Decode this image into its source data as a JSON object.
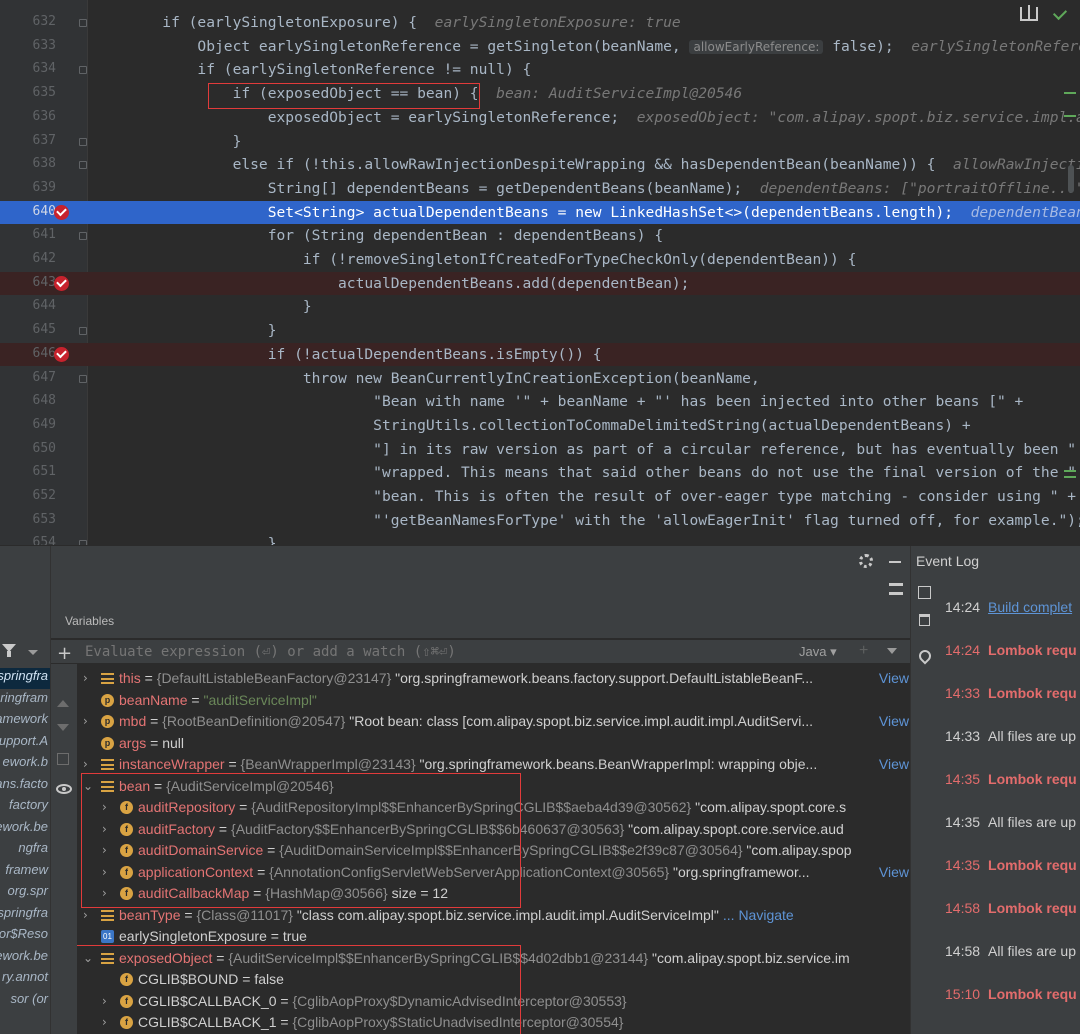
{
  "editor": {
    "lines": [
      {
        "num": "632",
        "code": "        if (earlySingletonExposure) {  ",
        "hint": "earlySingletonExposure: true"
      },
      {
        "num": "633",
        "code": "            Object earlySingletonReference = getSingleton(beanName, ",
        "hintbox": "allowEarlyReference:",
        "code2": " false);  ",
        "hint": "earlySingletonReference"
      },
      {
        "num": "634",
        "code": "            if (earlySingletonReference != null) {"
      },
      {
        "num": "635",
        "code": "                if (exposedObject == bean) {  ",
        "hint": "bean: AuditServiceImpl@20546"
      },
      {
        "num": "636",
        "code": "                    exposedObject = earlySingletonReference;  ",
        "hint": "exposedObject: \"com.alipay.spopt.biz.service.impl.audit"
      },
      {
        "num": "637",
        "code": "                }"
      },
      {
        "num": "638",
        "code": "                else if (!this.allowRawInjectionDespiteWrapping && hasDependentBean(beanName)) {  ",
        "hint": "allowRawInjectionDe"
      },
      {
        "num": "639",
        "code": "                    String[] dependentBeans = getDependentBeans(beanName);  ",
        "hint": "dependentBeans: [\"portraitOffline...\"]"
      },
      {
        "num": "640",
        "code": "                    Set<String> actualDependentBeans = new LinkedHashSet<>(dependentBeans.length);  ",
        "hint": "dependentBeans: ["
      },
      {
        "num": "641",
        "code": "                    for (String dependentBean : dependentBeans) {"
      },
      {
        "num": "642",
        "code": "                        if (!removeSingletonIfCreatedForTypeCheckOnly(dependentBean)) {"
      },
      {
        "num": "643",
        "code": "                            actualDependentBeans.add(dependentBean);"
      },
      {
        "num": "644",
        "code": "                        }"
      },
      {
        "num": "645",
        "code": "                    }"
      },
      {
        "num": "646",
        "code": "                    if (!actualDependentBeans.isEmpty()) {"
      },
      {
        "num": "647",
        "code": "                        throw new BeanCurrentlyInCreationException(beanName,"
      },
      {
        "num": "648",
        "code": "                                \"Bean with name '\" + beanName + \"' has been injected into other beans [\" +"
      },
      {
        "num": "649",
        "code": "                                StringUtils.collectionToCommaDelimitedString(actualDependentBeans) +"
      },
      {
        "num": "650",
        "code": "                                \"] in its raw version as part of a circular reference, but has eventually been \" +"
      },
      {
        "num": "651",
        "code": "                                \"wrapped. This means that said other beans do not use the final version of the \" +"
      },
      {
        "num": "652",
        "code": "                                \"bean. This is often the result of over-eager type matching - consider using \" +"
      },
      {
        "num": "653",
        "code": "                                \"'getBeanNamesForType' with the 'allowEagerInit' flag turned off, for example.\");"
      },
      {
        "num": "654",
        "code": "                    }"
      }
    ]
  },
  "debugger": {
    "frames": [
      "springfra",
      "springfram",
      "framework",
      "upport.A",
      "ework.b",
      "ans.facto",
      "factory",
      "ework.be",
      "ngfra",
      "framew",
      "org.spr",
      "springfra",
      "or$Reso",
      "ework.be",
      "ry.annot",
      "sor (or"
    ],
    "variables_title": "Variables",
    "eval_placeholder": "Evaluate expression (⏎) or add a watch (⇧⌘⏎)",
    "language": "Java ▾",
    "rows": [
      {
        "arrow": "›",
        "icon": "obj",
        "name": "this",
        "type": "{DefaultListableBeanFactory@23147}",
        "value": " \"org.springframework.beans.factory.support.DefaultListableBeanF...",
        "link": "View"
      },
      {
        "arrow": "",
        "icon": "param",
        "name": "beanName",
        "type": "",
        "value": "\"auditServiceImpl\"",
        "str": true
      },
      {
        "arrow": "›",
        "icon": "param",
        "name": "mbd",
        "type": "{RootBeanDefinition@20547}",
        "value": " \"Root bean: class [com.alipay.spopt.biz.service.impl.audit.impl.AuditServi...",
        "link": "View"
      },
      {
        "arrow": "",
        "icon": "param",
        "name": "args",
        "type": "",
        "value": "null",
        "plain": true
      },
      {
        "arrow": "›",
        "icon": "obj",
        "name": "instanceWrapper",
        "type": "{BeanWrapperImpl@23143}",
        "value": " \"org.springframework.beans.BeanWrapperImpl: wrapping obje...",
        "link": "View"
      },
      {
        "arrow": "⌄",
        "icon": "obj",
        "name": "bean",
        "type": "{AuditServiceImpl@20546}",
        "value": ""
      },
      {
        "arrow": "›",
        "icon": "field",
        "indent": 1,
        "name": "auditRepository",
        "type": "{AuditRepositoryImpl$$EnhancerBySpringCGLIB$$aeba4d39@30562}",
        "value": " \"com.alipay.spopt.core.s"
      },
      {
        "arrow": "›",
        "icon": "field",
        "indent": 1,
        "name": "auditFactory",
        "type": "{AuditFactory$$EnhancerBySpringCGLIB$$6b460637@30563}",
        "value": " \"com.alipay.spopt.core.service.aud"
      },
      {
        "arrow": "›",
        "icon": "field",
        "indent": 1,
        "name": "auditDomainService",
        "type": "{AuditDomainServiceImpl$$EnhancerBySpringCGLIB$$e2f39c87@30564}",
        "value": " \"com.alipay.spop"
      },
      {
        "arrow": "›",
        "icon": "field",
        "indent": 1,
        "name": "applicationContext",
        "type": "{AnnotationConfigServletWebServerApplicationContext@30565}",
        "value": " \"org.springframewor...",
        "link": "View"
      },
      {
        "arrow": "›",
        "icon": "field",
        "indent": 1,
        "name": "auditCallbackMap",
        "type": "{HashMap@30566}",
        "value": "  size = 12"
      },
      {
        "arrow": "›",
        "icon": "obj",
        "name": "beanType",
        "type": "{Class@11017}",
        "value": " \"class com.alipay.spopt.biz.service.impl.audit.impl.AuditServiceImpl\"",
        "link": "... Navigate",
        "linkInline": true
      },
      {
        "arrow": "",
        "icon": "bool",
        "name": "earlySingletonExposure",
        "type": "",
        "value": "true",
        "plain": true,
        "plainName": true
      },
      {
        "arrow": "⌄",
        "icon": "obj",
        "name": "exposedObject",
        "type": "{AuditServiceImpl$$EnhancerBySpringCGLIB$$4d02dbb1@23144}",
        "value": " \"com.alipay.spopt.biz.service.im"
      },
      {
        "arrow": "",
        "icon": "field",
        "indent": 1,
        "name": "CGLIB$BOUND",
        "type": "",
        "value": "false",
        "plain": true,
        "plainName": true
      },
      {
        "arrow": "›",
        "icon": "field",
        "indent": 1,
        "name": "CGLIB$CALLBACK_0",
        "type": "{CglibAopProxy$DynamicAdvisedInterceptor@30553}",
        "value": "",
        "plainName": true
      },
      {
        "arrow": "›",
        "icon": "field",
        "indent": 1,
        "name": "CGLIB$CALLBACK_1",
        "type": "{CglibAopProxy$StaticUnadvisedInterceptor@30554}",
        "value": "",
        "plainName": true
      }
    ]
  },
  "event_log": {
    "title": "Event Log",
    "entries": [
      {
        "time": "14:24",
        "msg": "Build complet",
        "kind": "link"
      },
      {
        "time": "14:24",
        "msg": "Lombok requ",
        "kind": "err"
      },
      {
        "time": "14:33",
        "msg": "Lombok requ",
        "kind": "err"
      },
      {
        "time": "14:33",
        "msg": "All files are up",
        "kind": "info"
      },
      {
        "time": "14:35",
        "msg": "Lombok requ",
        "kind": "err"
      },
      {
        "time": "14:35",
        "msg": "All files are up",
        "kind": "info"
      },
      {
        "time": "14:35",
        "msg": "Lombok requ",
        "kind": "err"
      },
      {
        "time": "14:58",
        "msg": "Lombok requ",
        "kind": "err"
      },
      {
        "time": "14:58",
        "msg": "All files are up",
        "kind": "info"
      },
      {
        "time": "15:10",
        "msg": "Lombok requ",
        "kind": "err"
      }
    ]
  }
}
